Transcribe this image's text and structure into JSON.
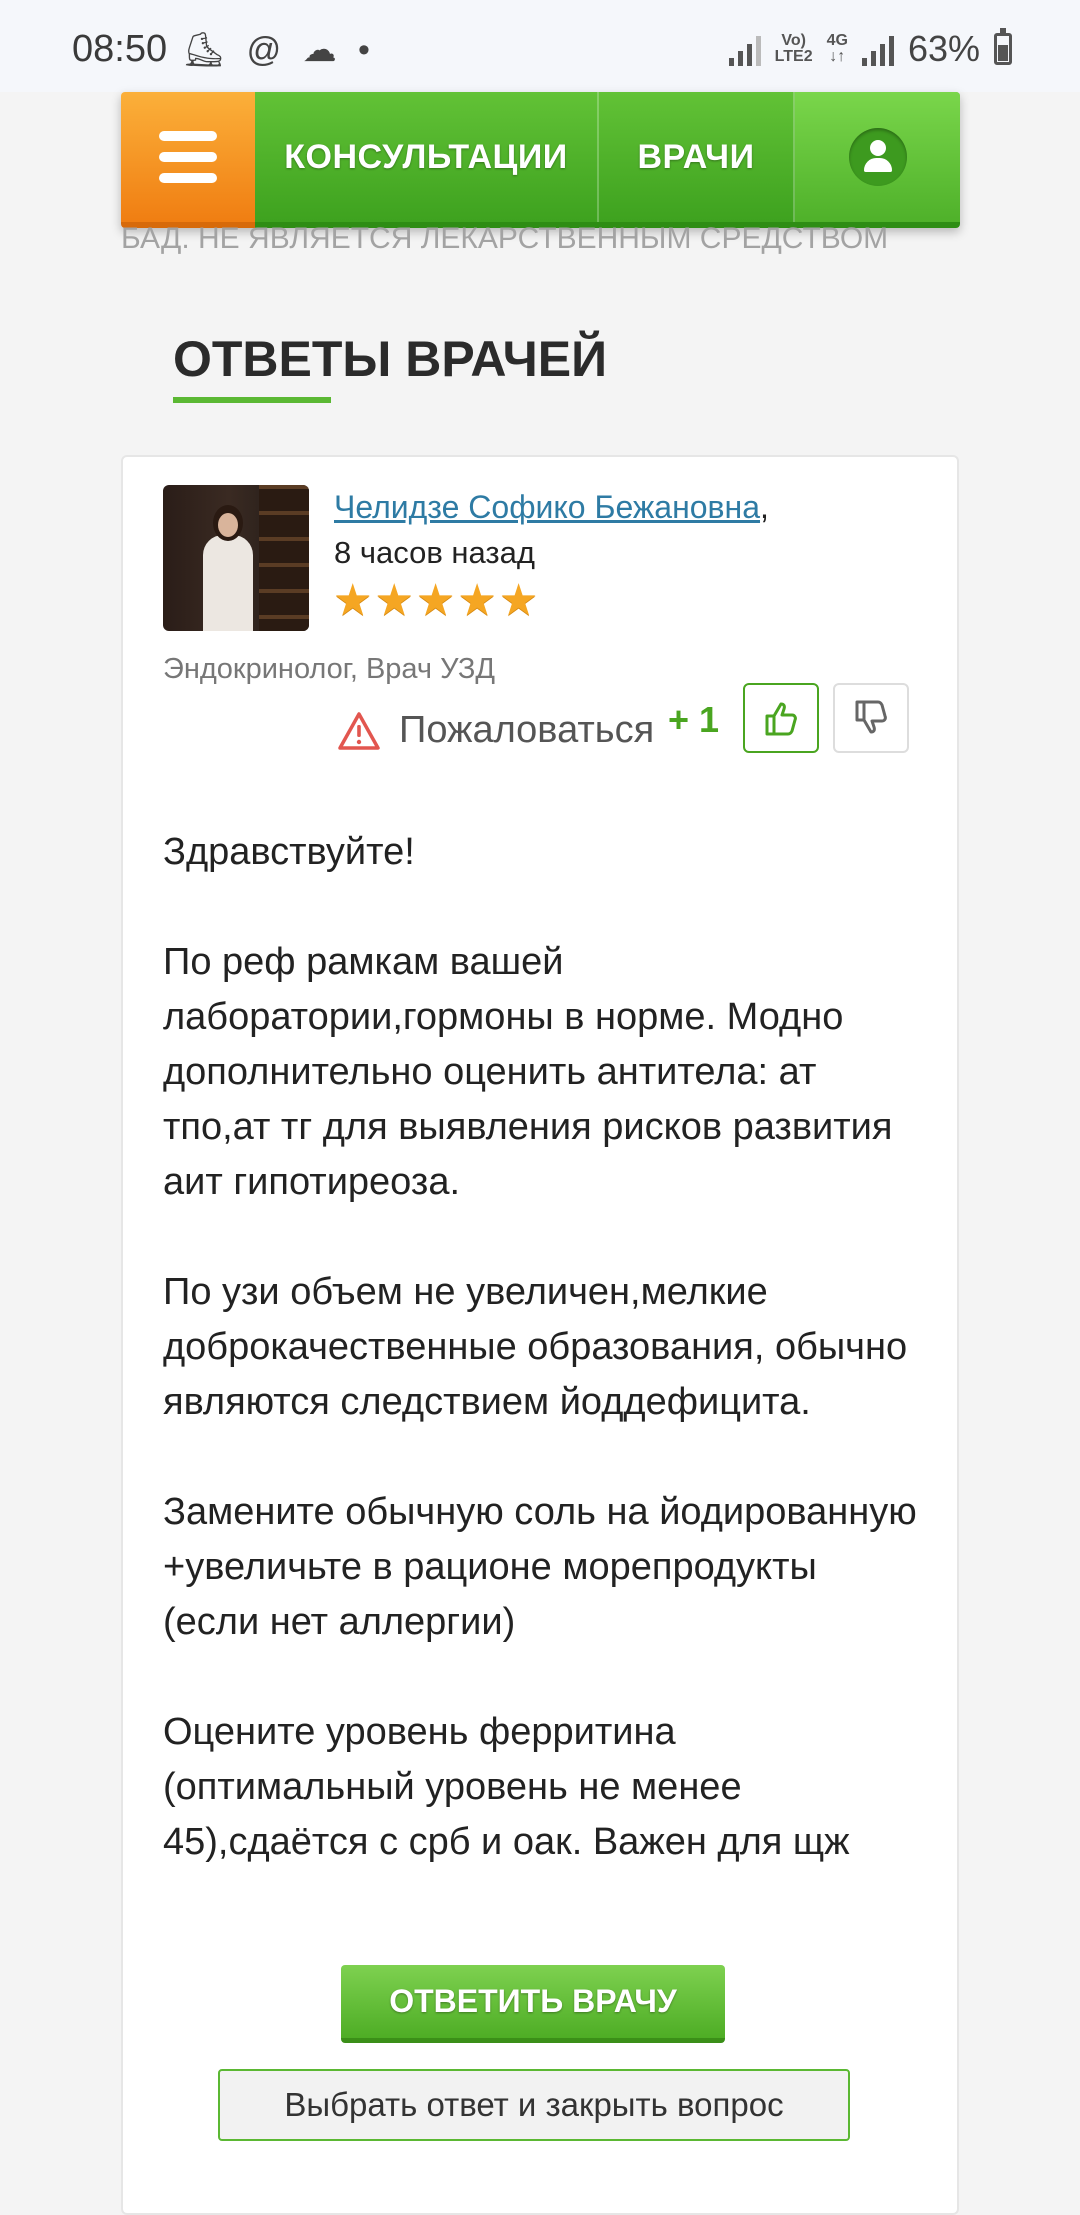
{
  "status_bar": {
    "time": "08:50",
    "left_icons": [
      "direction-icon",
      "at-icon",
      "cloud-icon",
      "dot-icon"
    ],
    "network_label_top": "Vo)",
    "network_label_bottom": "LTE2",
    "network2_top": "4G",
    "network2_bottom": "↓↑",
    "battery": "63%"
  },
  "nav": {
    "menu_icon": "hamburger-icon",
    "consultations": "КОНСУЛЬТАЦИИ",
    "doctors": "ВРАЧИ",
    "user_icon": "user-icon"
  },
  "notice": "БАД. НЕ ЯВЛЯЕТСЯ ЛЕКАРСТВЕННЫМ СРЕДСТВОМ",
  "section": {
    "title": "ОТВЕТЫ ВРАЧЕЙ",
    "accent_color": "#5bb833"
  },
  "answer_card": {
    "doctor_name": "Челидзе Софико Бежановна",
    "name_suffix": ",",
    "time_ago": "8 часов назад",
    "rating_stars": 5,
    "specialty": "Эндокринолог, Врач УЗД",
    "complain_label": "Пожаловаться",
    "vote_count": "+ 1",
    "paragraphs": [
      "Здравствуйте!",
      "По реф рамкам вашей лаборатории,гормоны в норме. Модно дополнительно оценить антитела: ат тпо,ат тг для выявления рисков развития аит гипотиреоза.",
      "По узи объем не увеличен,мелкие доброкачественные образования, обычно являются следствием йоддефицита.",
      "Замените обычную соль на йодированную +увеличьте в рационе морепродукты (если нет аллергии)",
      "Оцените уровень ферритина (оптимальный уровень не менее 45),сдаётся с срб и оак. Важен для щж"
    ],
    "reply_button": "ОТВЕТИТЬ ВРАЧУ",
    "close_button": "Выбрать ответ и закрыть вопрос"
  }
}
